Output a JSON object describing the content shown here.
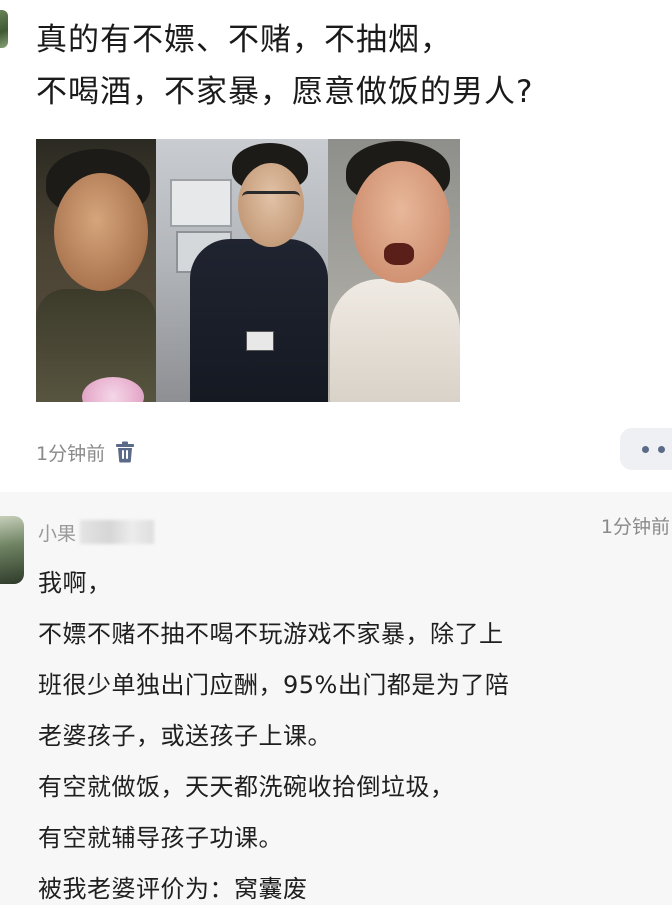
{
  "post": {
    "title": "真的有不嫖、不赌，不抽烟，\n不喝酒，不家暴，愿意做饭的男人?",
    "time": "1分钟前",
    "delete_icon": "trash-icon",
    "more_icon": "more-icon"
  },
  "comment": {
    "author_partial": "小果",
    "time": "1分钟前",
    "lines": [
      "我啊，",
      "不嫖不赌不抽不喝不玩游戏不家暴，除了上",
      "班很少单独出门应酬，95%出门都是为了陪",
      "老婆孩子，或送孩子上课。",
      "有空就做饭，天天都洗碗收拾倒垃圾，",
      "有空就辅导孩子功课。",
      "被我老婆评价为：窝囊废"
    ]
  },
  "colors": {
    "post_bg": "#ffffff",
    "comment_bg": "#f7f7f7",
    "meta_text": "#8a8a8a",
    "icon_accent": "#5a6a88"
  }
}
